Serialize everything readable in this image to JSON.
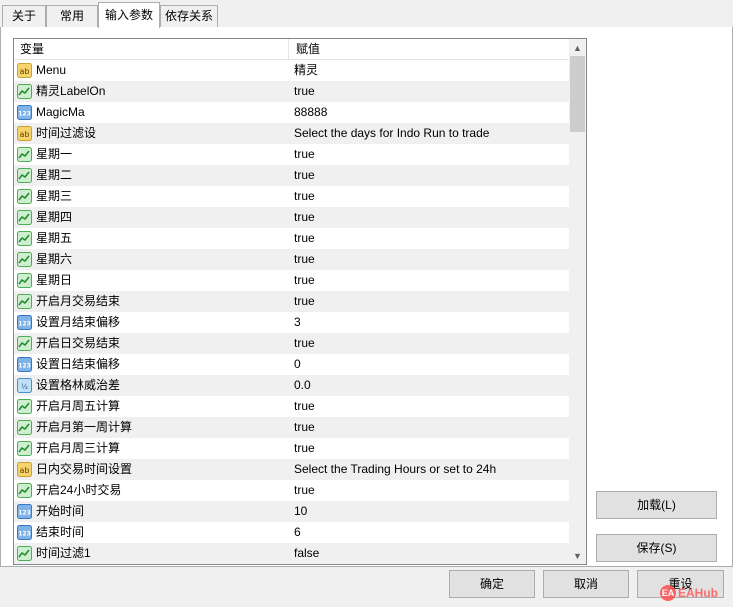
{
  "tabs": [
    {
      "label": "关于"
    },
    {
      "label": "常用"
    },
    {
      "label": "输入参数"
    },
    {
      "label": "依存关系"
    }
  ],
  "grid": {
    "headers": {
      "variable": "变量",
      "value": "赋值"
    },
    "rows": [
      {
        "type": "string",
        "name": "Menu",
        "value": "精灵"
      },
      {
        "type": "bool",
        "name": "精灵LabelOn",
        "value": "true"
      },
      {
        "type": "int",
        "name": "MagicMa",
        "value": "88888"
      },
      {
        "type": "string",
        "name": "时间过滤设",
        "value": "Select the days for Indo Run to trade"
      },
      {
        "type": "bool",
        "name": "星期一",
        "value": "true"
      },
      {
        "type": "bool",
        "name": "星期二",
        "value": "true"
      },
      {
        "type": "bool",
        "name": "星期三",
        "value": "true"
      },
      {
        "type": "bool",
        "name": "星期四",
        "value": "true"
      },
      {
        "type": "bool",
        "name": "星期五",
        "value": "true"
      },
      {
        "type": "bool",
        "name": "星期六",
        "value": "true"
      },
      {
        "type": "bool",
        "name": "星期日",
        "value": "true"
      },
      {
        "type": "bool",
        "name": "开启月交易结束",
        "value": "true"
      },
      {
        "type": "int",
        "name": "设置月结束偏移",
        "value": "3"
      },
      {
        "type": "bool",
        "name": "开启日交易结束",
        "value": "true"
      },
      {
        "type": "int",
        "name": "设置日结束偏移",
        "value": "0"
      },
      {
        "type": "double",
        "name": "设置格林威治差",
        "value": "0.0"
      },
      {
        "type": "bool",
        "name": "开启月周五计算",
        "value": "true"
      },
      {
        "type": "bool",
        "name": "开启月第一周计算",
        "value": "true"
      },
      {
        "type": "bool",
        "name": "开启月周三计算",
        "value": "true"
      },
      {
        "type": "string",
        "name": "日内交易时间设置",
        "value": "Select the Trading Hours or set to 24h"
      },
      {
        "type": "bool",
        "name": "开启24小时交易",
        "value": "true"
      },
      {
        "type": "int",
        "name": "开始时间",
        "value": "10"
      },
      {
        "type": "int",
        "name": "结束时间",
        "value": "6"
      },
      {
        "type": "bool",
        "name": "时间过滤1",
        "value": "false"
      }
    ]
  },
  "buttons": {
    "load": "加载(L)",
    "save": "保存(S)",
    "ok": "确定",
    "cancel": "取消",
    "reset": "重设"
  },
  "icons": {
    "string": "ab-string-icon",
    "bool": "bool-chart-icon",
    "int": "int-123-icon",
    "double": "double-fraction-icon"
  },
  "watermark": "EAHub"
}
